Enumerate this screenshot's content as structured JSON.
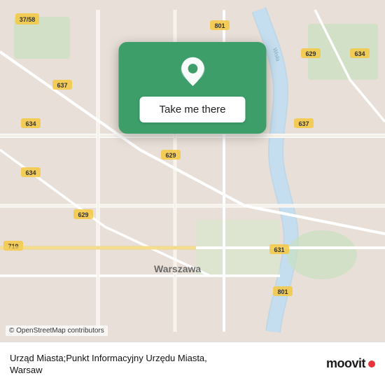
{
  "map": {
    "attribution": "© OpenStreetMap contributors",
    "center_city": "Warszawa"
  },
  "popup": {
    "button_label": "Take me there"
  },
  "info_bar": {
    "location_name": "Urząd Miasta;Punkt Informacyjny Urzędu Miasta,",
    "location_city": "Warsaw"
  },
  "moovit": {
    "logo_text": "moovit"
  },
  "icons": {
    "pin": "location-pin-icon",
    "moovit_dot": "moovit-dot-icon"
  }
}
